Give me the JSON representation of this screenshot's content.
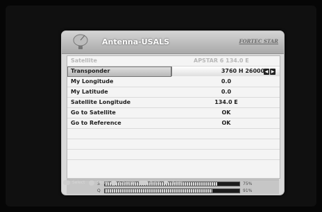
{
  "header": {
    "title": "Antenna-USALS",
    "brand": "FORTEC STAR",
    "dish_icon": "satellite-dish-icon"
  },
  "menu": {
    "satellite": {
      "label": "Satellite",
      "value": "APSTAR 6   134.0 E"
    },
    "rows": [
      {
        "label": "Transponder",
        "value": "3760 H 26000",
        "selected": true
      },
      {
        "label": "My Longitude",
        "value": "0.0"
      },
      {
        "label": "My Latitude",
        "value": "0.0"
      },
      {
        "label": "Satellite Longitude",
        "value": "134.0 E"
      },
      {
        "label": "Go to Satellite",
        "value": "OK"
      },
      {
        "label": "Go to Reference",
        "value": "OK"
      }
    ]
  },
  "signal": {
    "strength": {
      "label": "S",
      "percent_text": "75%",
      "level": 0.75
    },
    "quality": {
      "label": "Q",
      "percent_text": "91%",
      "level": 0.91
    }
  },
  "footer": {
    "select": "Select",
    "move": "Move",
    "change": "Change",
    "back": "Back",
    "save": "Save",
    "icons": [
      "ok-key-icon",
      "updown-key-icon",
      "leftright-key-icon",
      "exit-key-icon",
      "save-key-icon"
    ]
  },
  "colors": {
    "panel": "#d9d9d9",
    "selected_row": "#b8b8b8",
    "bar_fill": "#1c1c1c",
    "background": "#060606"
  }
}
